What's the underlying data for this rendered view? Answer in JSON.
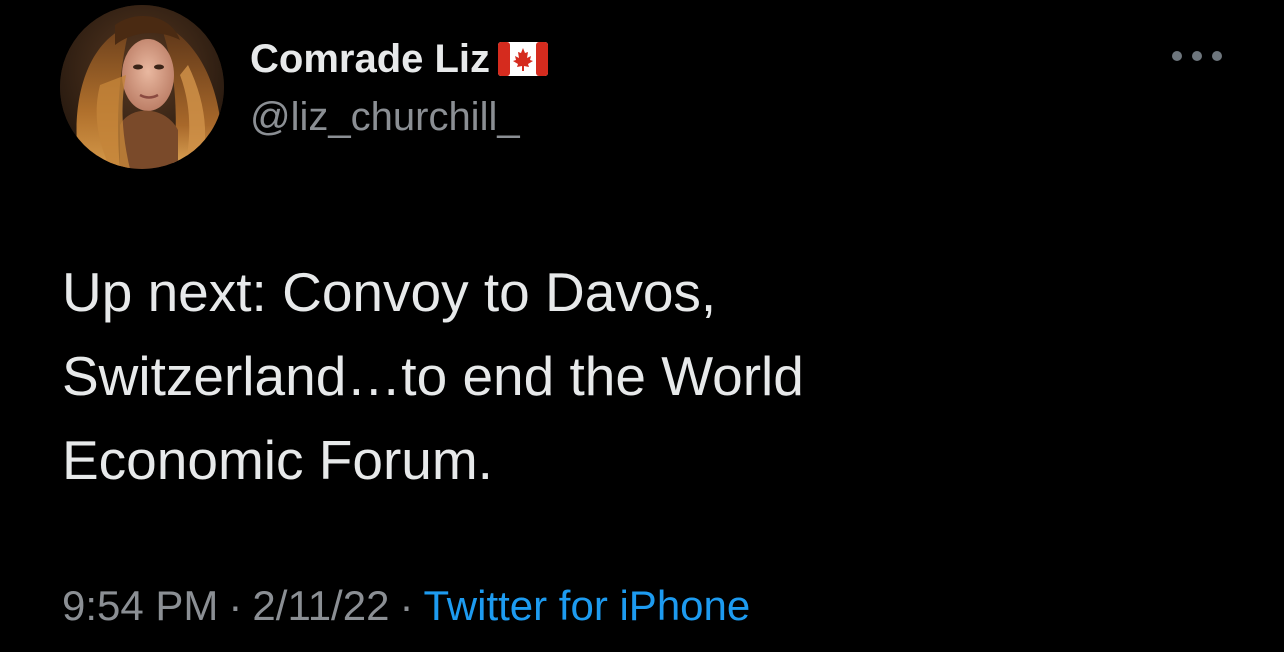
{
  "tweet": {
    "author": {
      "display_name": "Comrade Liz",
      "handle": "@liz_churchill_",
      "badge_icon": "canada-flag-icon"
    },
    "text": "Up next: Convoy to Davos,\nSwitzerland…to end the World\nEconomic Forum.",
    "time": "9:54 PM",
    "date": "2/11/22",
    "separator": "·",
    "source": "Twitter for iPhone",
    "more_icon": "more-options-icon"
  },
  "colors": {
    "background": "#000000",
    "primary_text": "#e7e9ea",
    "secondary_text": "#8b8f94",
    "link": "#1d9bf0"
  }
}
